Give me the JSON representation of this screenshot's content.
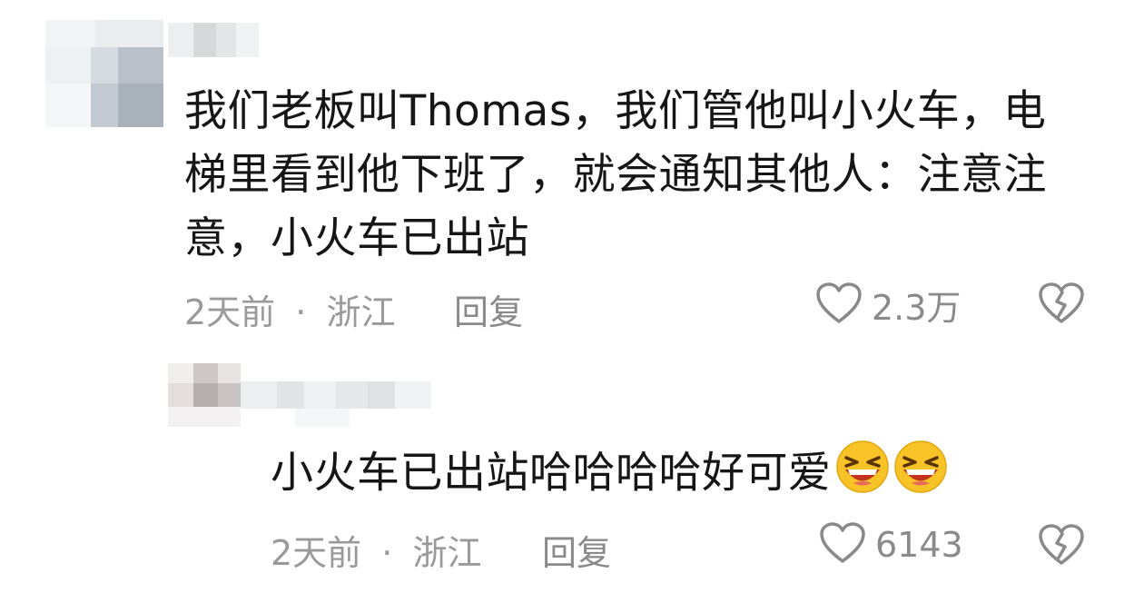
{
  "comments": [
    {
      "text_lines": [
        "我们老板叫Thomas，我们管他叫小火车，电",
        "梯里看到他下班了，就会通知其他人：注意注",
        "意，小火车已出站"
      ],
      "time": "2天前",
      "dot": "·",
      "location": "浙江",
      "reply_label": "回复",
      "likes": "2.3万"
    },
    {
      "text": "小火车已出站哈哈哈哈好可爱",
      "emojis": [
        "laughing-emoji",
        "laughing-emoji"
      ],
      "time": "2天前",
      "dot": "·",
      "location": "浙江",
      "reply_label": "回复",
      "likes": "6143"
    }
  ],
  "colors": {
    "text": "#161616",
    "meta": "#9a9a9a",
    "icon": "#8a8a8a"
  }
}
